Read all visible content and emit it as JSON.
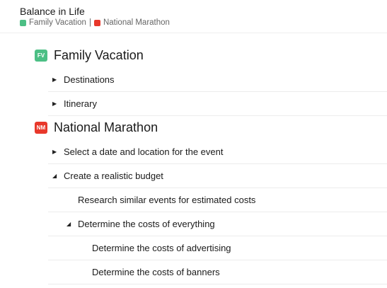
{
  "header": {
    "title": "Balance in Life",
    "projects": [
      {
        "name": "Family Vacation",
        "color": "#4cbf85"
      },
      {
        "name": "National Marathon",
        "color": "#e8382b"
      }
    ],
    "separator": "|"
  },
  "outline": [
    {
      "type": "group",
      "badge": "FV",
      "label": "Family Vacation",
      "color": "#4cbf85"
    },
    {
      "type": "item",
      "label": "Destinations",
      "expanded": false,
      "level": 1
    },
    {
      "type": "item",
      "label": "Itinerary",
      "expanded": false,
      "level": 1
    },
    {
      "type": "group",
      "badge": "NM",
      "label": "National Marathon",
      "color": "#e8382b"
    },
    {
      "type": "item",
      "label": "Select a date and location for the event",
      "expanded": false,
      "level": 1
    },
    {
      "type": "item",
      "label": "Create a realistic budget",
      "expanded": true,
      "level": 1
    },
    {
      "type": "leaf",
      "label": "Research similar events  for estimated costs",
      "level": 2
    },
    {
      "type": "item",
      "label": "Determine the costs of everything",
      "expanded": true,
      "level": 2
    },
    {
      "type": "leaf",
      "label": "Determine the costs of advertising",
      "level": 3
    },
    {
      "type": "leaf",
      "label": "Determine the costs of banners",
      "level": 3
    }
  ]
}
